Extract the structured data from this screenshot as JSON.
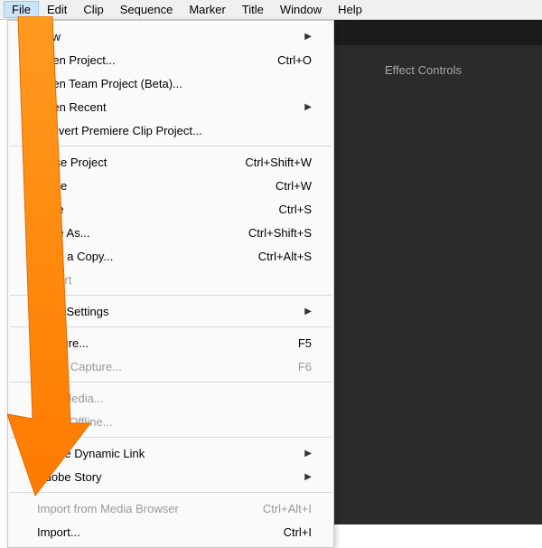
{
  "menubar": {
    "items": [
      {
        "label": "File",
        "active": true
      },
      {
        "label": "Edit"
      },
      {
        "label": "Clip"
      },
      {
        "label": "Sequence"
      },
      {
        "label": "Marker"
      },
      {
        "label": "Title"
      },
      {
        "label": "Window"
      },
      {
        "label": "Help"
      }
    ]
  },
  "panel": {
    "label": "Effect Controls"
  },
  "file_menu": {
    "items": [
      {
        "label": "New",
        "submenu": true
      },
      {
        "label": "Open Project...",
        "shortcut": "Ctrl+O"
      },
      {
        "label": "Open Team Project (Beta)..."
      },
      {
        "label": "Open Recent",
        "submenu": true
      },
      {
        "label": "Convert Premiere Clip Project..."
      },
      {
        "sep": true
      },
      {
        "label": "Close Project",
        "shortcut": "Ctrl+Shift+W"
      },
      {
        "label": "Close",
        "shortcut": "Ctrl+W"
      },
      {
        "label": "Save",
        "shortcut": "Ctrl+S"
      },
      {
        "label": "Save As...",
        "shortcut": "Ctrl+Shift+S"
      },
      {
        "label": "Save a Copy...",
        "shortcut": "Ctrl+Alt+S"
      },
      {
        "label": "Revert",
        "disabled": true
      },
      {
        "sep": true
      },
      {
        "label": "Sync Settings",
        "submenu": true
      },
      {
        "sep": true
      },
      {
        "label": "Capture...",
        "shortcut": "F5"
      },
      {
        "label": "Batch Capture...",
        "shortcut": "F6",
        "disabled": true
      },
      {
        "sep": true
      },
      {
        "label": "Link Media...",
        "disabled": true
      },
      {
        "label": "Make Offline...",
        "disabled": true
      },
      {
        "sep": true
      },
      {
        "label": "Adobe Dynamic Link",
        "submenu": true
      },
      {
        "label": "Adobe Story",
        "submenu": true
      },
      {
        "sep": true
      },
      {
        "label": "Import from Media Browser",
        "shortcut": "Ctrl+Alt+I",
        "disabled": true
      },
      {
        "label": "Import...",
        "shortcut": "Ctrl+I"
      }
    ]
  }
}
